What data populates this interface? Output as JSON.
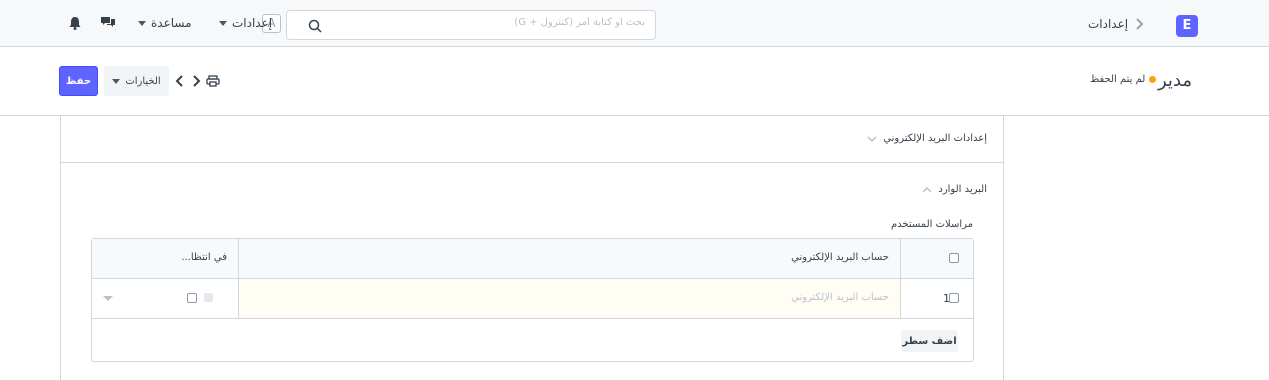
{
  "navbar": {
    "brand_letter": "E",
    "breadcrumb": "إعدادات",
    "search_placeholder": "بحث أو كتابة أمر (كنترول + G)",
    "avatar_letter": "A",
    "settings_label": "إعدادات",
    "help_label": "مساعدة",
    "icons": [
      "chevron-right-icon",
      "search-icon",
      "chat-icon",
      "bell-icon"
    ]
  },
  "page_head": {
    "title": "مدير",
    "indicator_text": "لم يتم الحفظ",
    "indicator_color": "#ffa00a",
    "save_label": "حفظ",
    "options_label": "الخيارات"
  },
  "form": {
    "section_title": "إعدادات البريد الإلكتروني",
    "subsection_title": "البريد الوارد",
    "grid_label": "مراسلات المستخدم",
    "grid": {
      "columns": [
        "حساب البريد الإلكتروني",
        "في انتظا..."
      ],
      "rows": [
        {
          "idx": "1",
          "email_placeholder": "حساب البريد الإلكتروني"
        }
      ],
      "add_row_label": "اضف سطر"
    }
  },
  "colors": {
    "primary": "#5e64ff",
    "border": "#d1d8dd",
    "navbar_bg": "#f7f8f9"
  }
}
